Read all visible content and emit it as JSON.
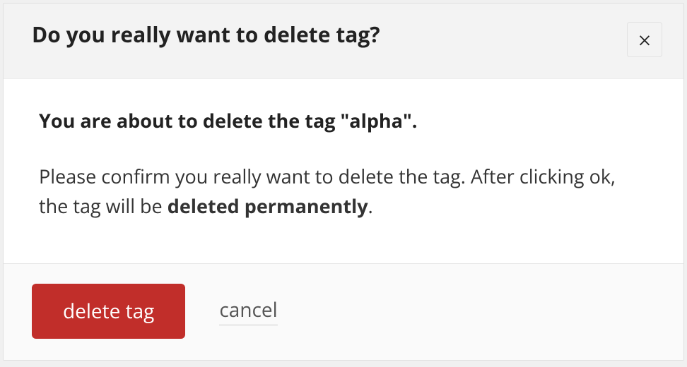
{
  "modal": {
    "title": "Do you really want to delete tag?",
    "close_icon": "close-icon",
    "body_strong": "You are about to delete the tag \"alpha\".",
    "body_text_prefix": "Please confirm you really want to delete the tag. After clicking ok, the tag will be ",
    "body_text_emph": "deleted permanently",
    "body_text_suffix": ".",
    "primary_label": "delete tag",
    "cancel_label": "cancel"
  }
}
